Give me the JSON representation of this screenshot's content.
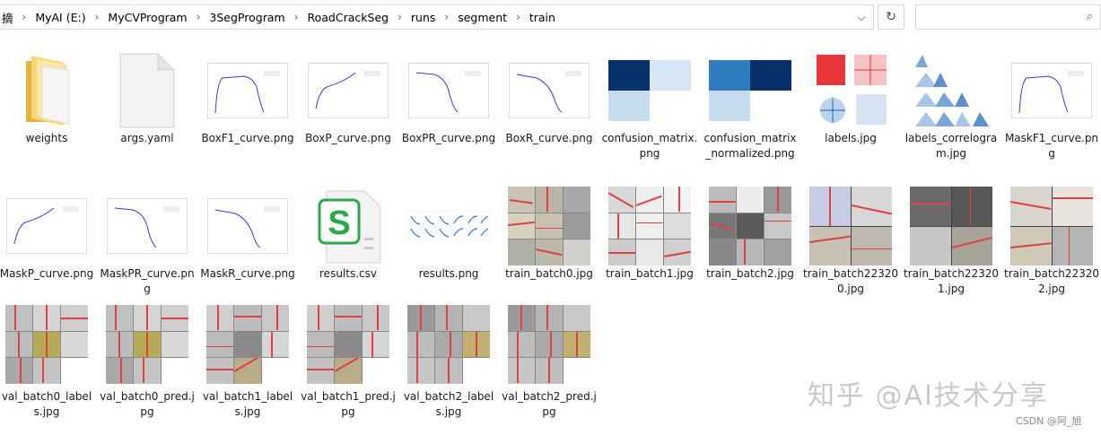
{
  "address_bar": {
    "crumbs": [
      "摘",
      "MyAI (E:)",
      "MyCVProgram",
      "3SegProgram",
      "RoadCrackSeg",
      "runs",
      "segment",
      "train"
    ],
    "dropdown_icon": "chevron-down-icon",
    "refresh_icon": "refresh-icon"
  },
  "search": {
    "placeholder": "",
    "icon": "search-icon"
  },
  "files": [
    {
      "name": "weights"
    },
    {
      "name": "args.yaml"
    },
    {
      "name": "BoxF1_curve.png"
    },
    {
      "name": "BoxP_curve.png"
    },
    {
      "name": "BoxPR_curve.png"
    },
    {
      "name": "BoxR_curve.png"
    },
    {
      "name": "confusion_matrix.png"
    },
    {
      "name": "confusion_matrix_normalized.png"
    },
    {
      "name": "labels.jpg"
    },
    {
      "name": "labels_correlogram.jpg"
    },
    {
      "name": "MaskF1_curve.png"
    },
    {
      "name": "MaskP_curve.png"
    },
    {
      "name": "MaskPR_curve.png"
    },
    {
      "name": "MaskR_curve.png"
    },
    {
      "name": "results.csv"
    },
    {
      "name": "results.png"
    },
    {
      "name": "train_batch0.jpg"
    },
    {
      "name": "train_batch1.jpg"
    },
    {
      "name": "train_batch2.jpg"
    },
    {
      "name": "train_batch223200.jpg"
    },
    {
      "name": "train_batch223201.jpg"
    },
    {
      "name": "train_batch223202.jpg"
    },
    {
      "name": "val_batch0_labels.jpg"
    },
    {
      "name": "val_batch0_pred.jpg"
    },
    {
      "name": "val_batch1_labels.jpg"
    },
    {
      "name": "val_batch1_pred.jpg"
    },
    {
      "name": "val_batch2_labels.jpg"
    },
    {
      "name": "val_batch2_pred.jpg"
    }
  ],
  "watermark": "知乎 @AI技术分享",
  "csdn_mark": "CSDN @阿_旭",
  "colors": {
    "folder": "#f5c242",
    "cm_dark": "#08306b",
    "cm_light": "#c6dbef",
    "crack": "#e04040"
  }
}
